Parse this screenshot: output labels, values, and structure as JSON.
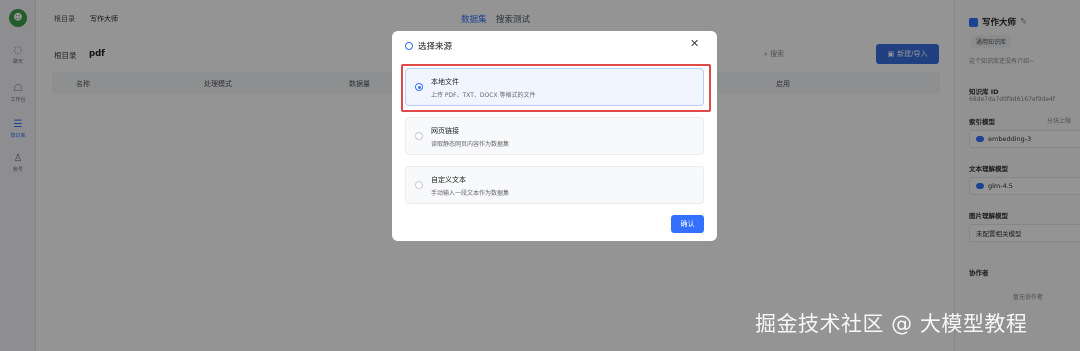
{
  "nav": {
    "items": [
      {
        "label": "聊天",
        "icon": "chat-icon"
      },
      {
        "label": "工作台",
        "icon": "workbench-icon"
      },
      {
        "label": "知识库",
        "icon": "database-icon"
      },
      {
        "label": "账号",
        "icon": "user-icon"
      }
    ]
  },
  "header": {
    "breadcrumb_root": "根目录",
    "breadcrumb_current": "写作大师",
    "tabs": [
      "数据集",
      "搜索测试"
    ]
  },
  "toolbar": {
    "crumb_root": "根目录",
    "folder_name": "pdf",
    "search_placeholder": "搜索",
    "new_button": "新建/导入"
  },
  "table": {
    "columns": [
      "名称",
      "处理模式",
      "数据量",
      "启用"
    ]
  },
  "right_panel": {
    "title": "写作大师",
    "badge": "通用知识库",
    "intro": "这个知识库还没有介绍~",
    "id_label": "知识库 ID",
    "id_value": "68de7da7d0f9d6167ef9de4f",
    "index_model_label": "索引模型",
    "chunk_label": "分块上限",
    "index_model": "embedding-3",
    "text_model_label": "文本理解模型",
    "text_model": "glm-4.5",
    "image_model_label": "图片理解模型",
    "image_model": "未配置相关模型",
    "collab_label": "协作者",
    "collab_empty": "暂无协作者"
  },
  "modal": {
    "title": "选择来源",
    "options": [
      {
        "title": "本地文件",
        "desc": "上传 PDF、TXT、DOCX 等格式的文件"
      },
      {
        "title": "网页链接",
        "desc": "读取静态网页内容作为数据集"
      },
      {
        "title": "自定义文本",
        "desc": "手动输入一段文本作为数据集"
      }
    ],
    "confirm": "确认"
  },
  "watermark": "掘金技术社区 @ 大模型教程",
  "colors": {
    "accent": "#3370ff",
    "highlight_border": "#e04a4a",
    "avatar": "#3fa14b"
  }
}
